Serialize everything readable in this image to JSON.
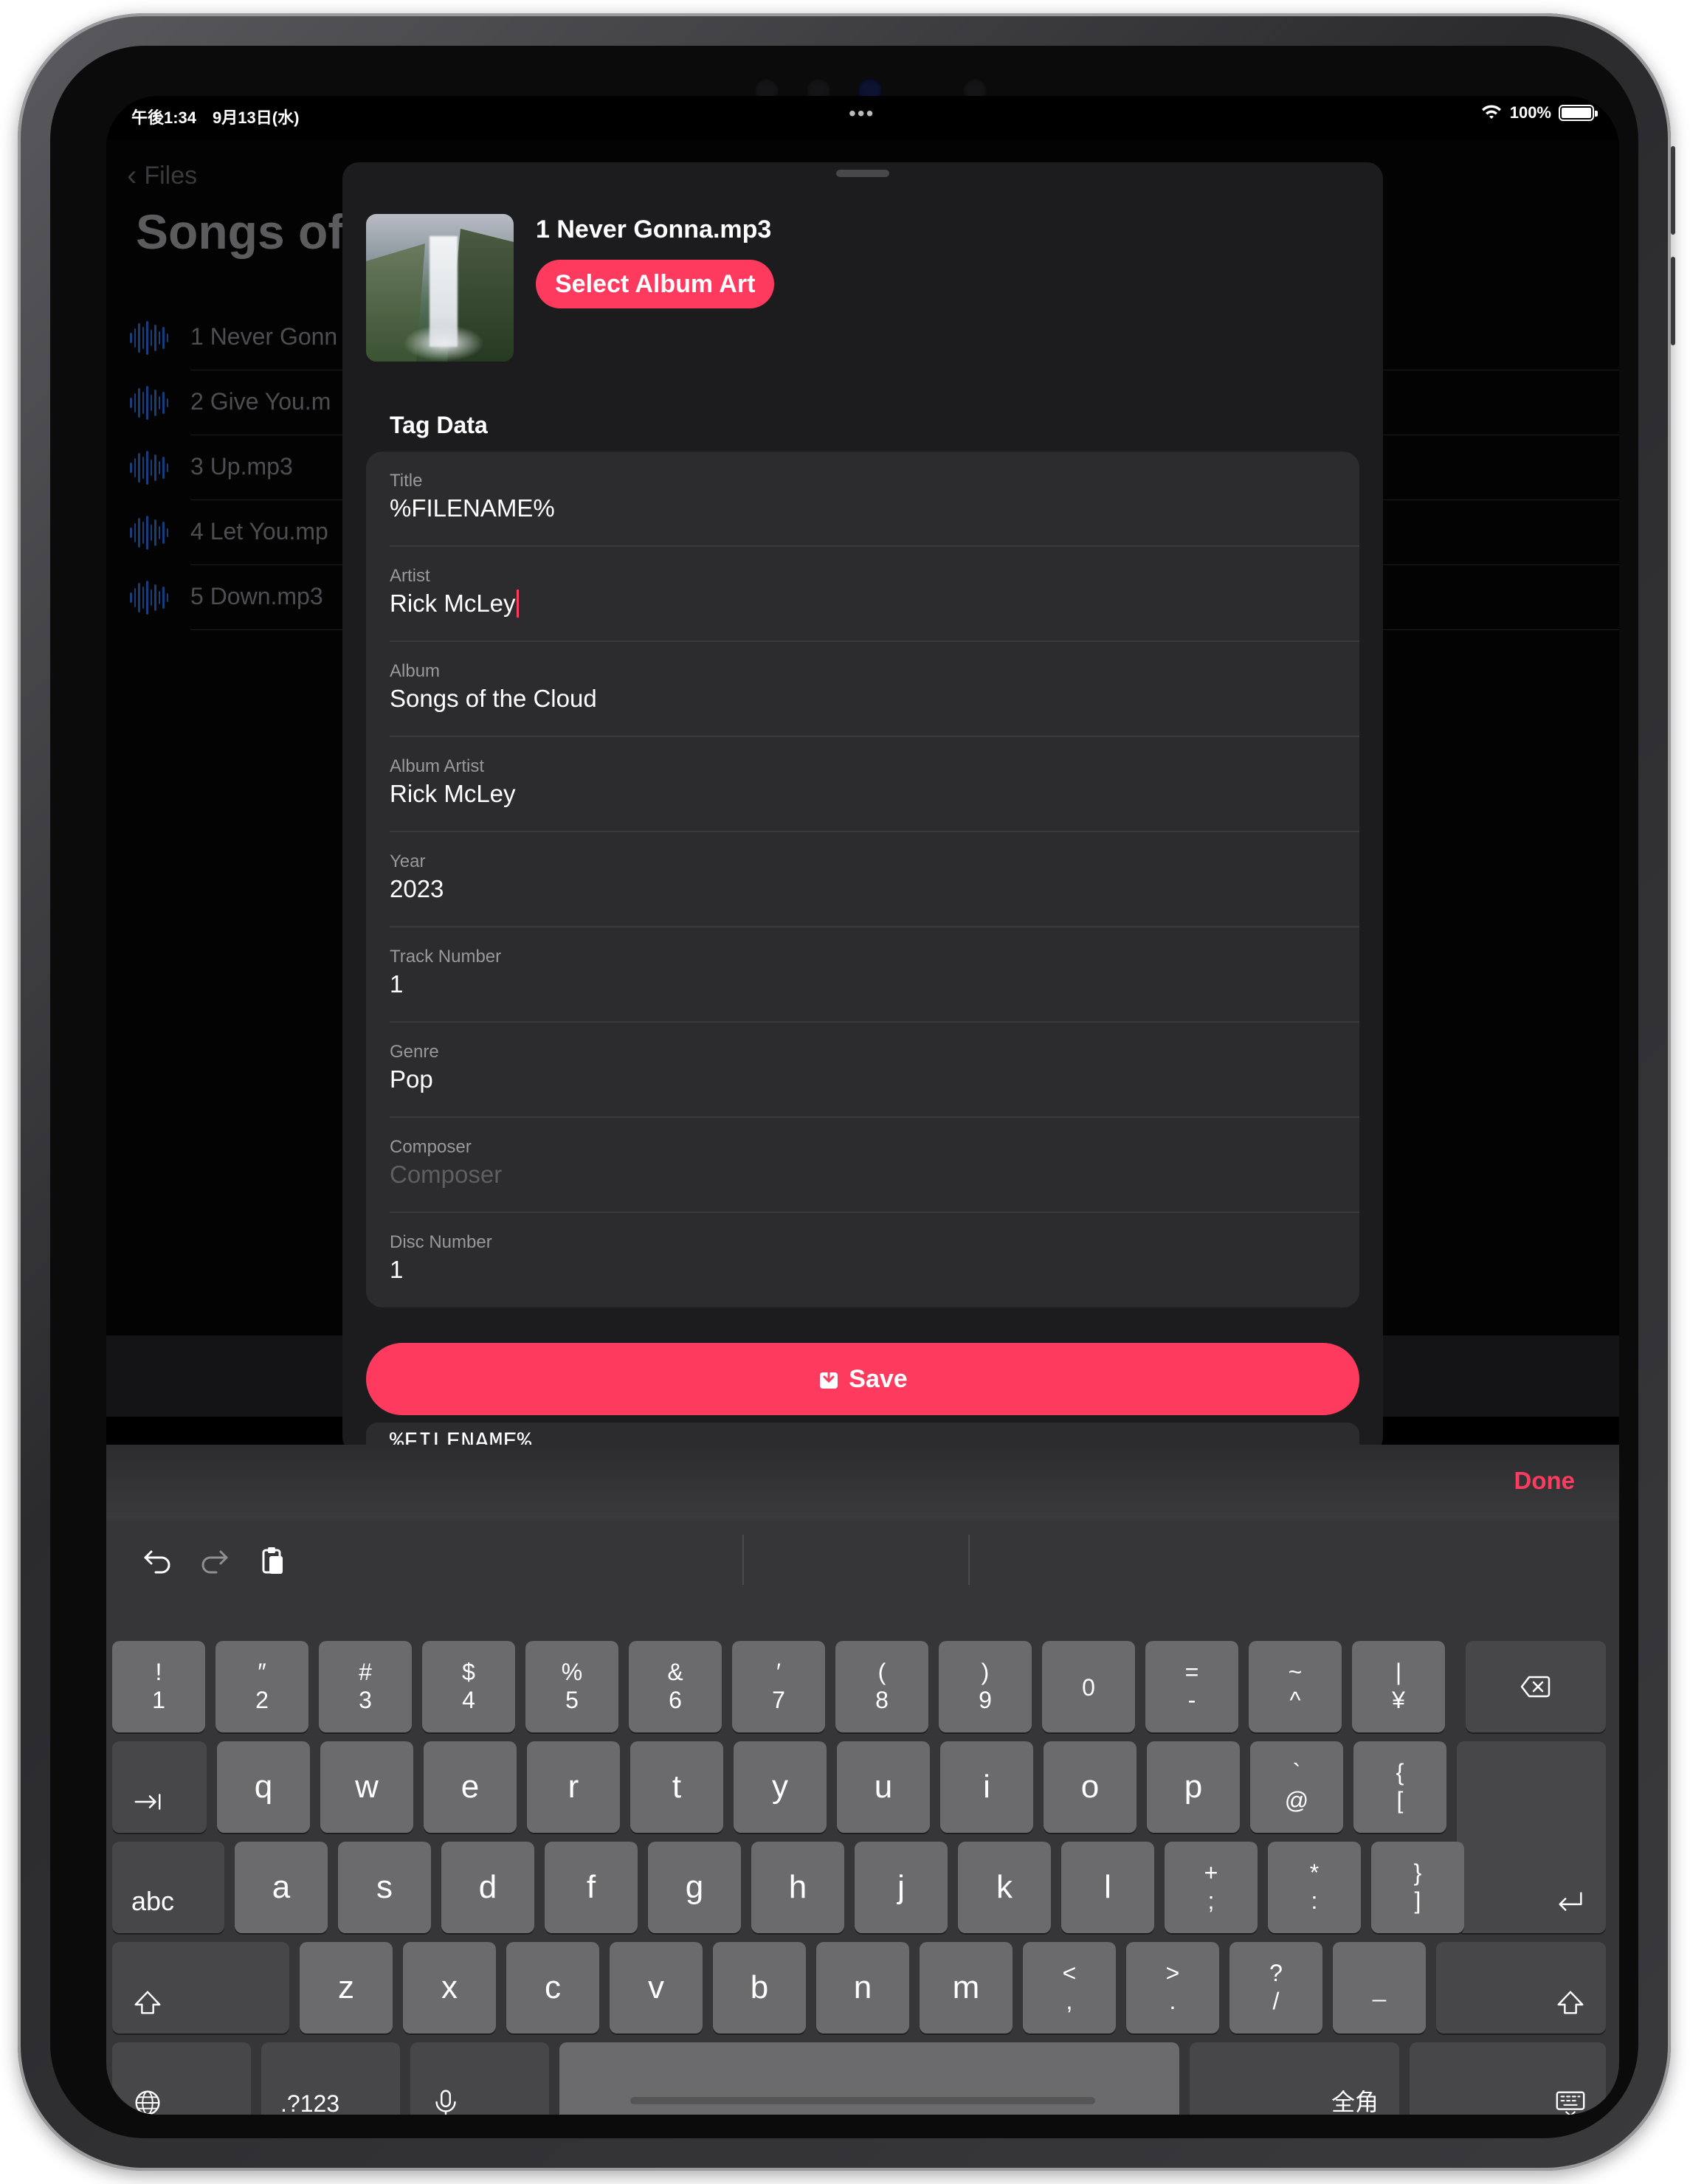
{
  "status_bar": {
    "time": "午後1:34　9月13日(水)",
    "battery": "100%",
    "battery_level": 1.0
  },
  "background": {
    "back_label": "Files",
    "title": "Songs of",
    "rows": [
      "1 Never Gonn",
      "2 Give You.m",
      "3 Up.mp3",
      "4 Let You.mp",
      "5 Down.mp3"
    ]
  },
  "sheet": {
    "filename": "1 Never Gonna.mp3",
    "album_art_button": "Select Album Art",
    "section_title": "Tag Data",
    "fields": [
      {
        "label": "Title",
        "value": "%FILENAME%",
        "placeholder": false
      },
      {
        "label": "Artist",
        "value": "Rick McLey",
        "placeholder": false,
        "focused": true
      },
      {
        "label": "Album",
        "value": "Songs of the Cloud",
        "placeholder": false
      },
      {
        "label": "Album Artist",
        "value": "Rick McLey",
        "placeholder": false
      },
      {
        "label": "Year",
        "value": "2023",
        "placeholder": false
      },
      {
        "label": "Track Number",
        "value": "1",
        "placeholder": false
      },
      {
        "label": "Genre",
        "value": "Pop",
        "placeholder": false
      },
      {
        "label": "Composer",
        "value": "Composer",
        "placeholder": true
      },
      {
        "label": "Disc Number",
        "value": "1",
        "placeholder": false
      }
    ],
    "save_label": "Save",
    "below_text": "%FILENAME%"
  },
  "accessory": {
    "done_label": "Done"
  },
  "keyboard": {
    "row1": [
      [
        "!",
        "1"
      ],
      [
        "″",
        "2"
      ],
      [
        "#",
        "3"
      ],
      [
        "$",
        "4"
      ],
      [
        "%",
        "5"
      ],
      [
        "&",
        "6"
      ],
      [
        "′",
        "7"
      ],
      [
        "(",
        "8"
      ],
      [
        ")",
        "9"
      ],
      [
        "",
        "0"
      ],
      [
        "=",
        "-"
      ],
      [
        "~",
        "^"
      ],
      [
        "|",
        "¥"
      ]
    ],
    "row2": [
      "q",
      "w",
      "e",
      "r",
      "t",
      "y",
      "u",
      "i",
      "o",
      "p"
    ],
    "row2_extra": [
      [
        "`",
        "@"
      ],
      [
        "{",
        "["
      ]
    ],
    "row3": [
      "a",
      "s",
      "d",
      "f",
      "g",
      "h",
      "j",
      "k",
      "l"
    ],
    "row3_extra": [
      [
        "+",
        ";"
      ],
      [
        "*",
        ":"
      ],
      [
        "}",
        "]"
      ]
    ],
    "row4": [
      "z",
      "x",
      "c",
      "v",
      "b",
      "n",
      "m"
    ],
    "row4_extra": [
      [
        "<",
        ","
      ],
      [
        ">",
        "."
      ],
      [
        "?",
        "/"
      ],
      [
        "",
        "_"
      ]
    ],
    "abc_label": "abc",
    "numbers_label": ".?123",
    "kana_label": "全角"
  },
  "colors": {
    "accent": "#fe3b5e",
    "sheet_bg": "#1c1c1e",
    "field_bg": "#2c2c2e"
  }
}
